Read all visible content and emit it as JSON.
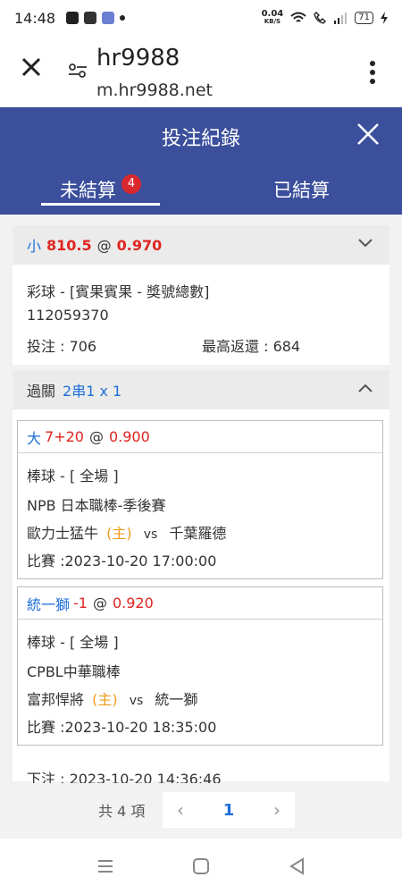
{
  "status": {
    "time": "14:48",
    "speed_value": "0.04",
    "speed_unit": "KB/S",
    "battery": "71"
  },
  "browser": {
    "title": "hr9988",
    "url": "m.hr9988.net"
  },
  "header": {
    "title": "投注紀錄"
  },
  "tabs": [
    {
      "label": "未結算",
      "badge": "4",
      "active": true
    },
    {
      "label": "已結算",
      "active": false
    }
  ],
  "bet1": {
    "pick": "小",
    "line": "810.5",
    "at": "@",
    "odds": "0.970",
    "category": "彩球 - [賓果賓果 - 獎號總數]",
    "bet_id": "112059370",
    "stake_label": "投注 : 706",
    "max_return_label": "最高返還 : 684"
  },
  "bet2": {
    "type_label": "過關",
    "combo": "2串1 x 1",
    "legs": [
      {
        "pick": "大",
        "handicap": "7+20",
        "at": "@",
        "odds": "0.900",
        "sport": "棒球 - [ 全場 ]",
        "league": "NPB 日本職棒-季後賽",
        "home": "歐力士猛牛",
        "home_tag": "(主)",
        "vs": "vs",
        "away": "千葉羅德",
        "match_time": "比賽 :2023-10-20 17:00:00"
      },
      {
        "pick": "統一獅",
        "handicap": "-1",
        "at": "@",
        "odds": "0.920",
        "sport": "棒球 - [ 全場 ]",
        "league": "CPBL中華職棒",
        "home": "富邦悍將",
        "home_tag": "(主)",
        "vs": "vs",
        "away": "統一獅",
        "match_time": "比賽 :2023-10-20 18:35:00"
      }
    ],
    "placed": "下注 : 2023-10-20 14:36:46"
  },
  "pager": {
    "total": "共 4 項",
    "prev": "‹",
    "current": "1",
    "next": "›"
  },
  "colors": {
    "primary": "#3b4f9c",
    "accent_blue": "#1e6fd9",
    "accent_red": "#e0241f",
    "home_orange": "#ef9a1e",
    "badge_red": "#d9272e"
  }
}
